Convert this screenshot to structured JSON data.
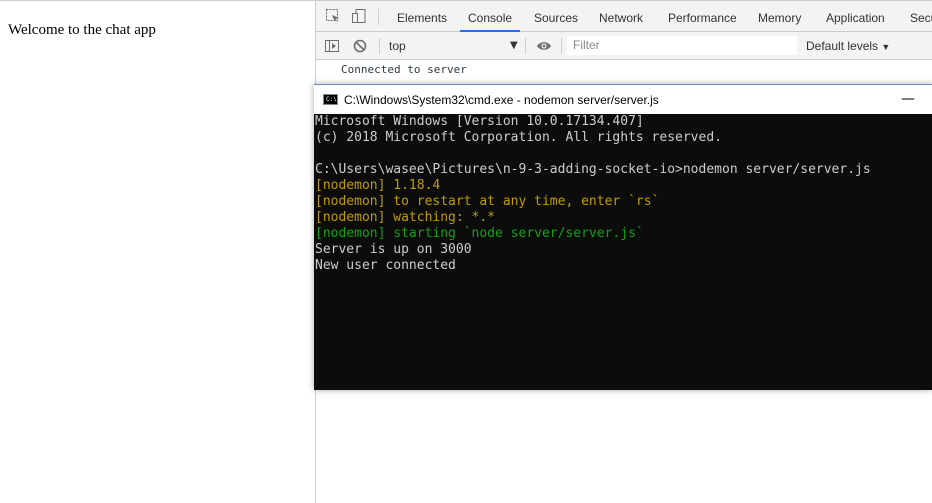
{
  "page": {
    "welcome_text": "Welcome to the chat app"
  },
  "devtools": {
    "tabs": [
      {
        "label": "Elements",
        "active": false
      },
      {
        "label": "Console",
        "active": true
      },
      {
        "label": "Sources",
        "active": false
      },
      {
        "label": "Network",
        "active": false
      },
      {
        "label": "Performance",
        "active": false
      },
      {
        "label": "Memory",
        "active": false
      },
      {
        "label": "Application",
        "active": false
      },
      {
        "label": "Secu",
        "active": false
      }
    ],
    "console": {
      "context": "top",
      "filter_placeholder": "Filter",
      "levels": "Default levels",
      "log": "Connected to server"
    },
    "accent_color": "#1a73e8"
  },
  "cmd": {
    "title": "C:\\Windows\\System32\\cmd.exe - nodemon  server/server.js",
    "icon_text": "C:\\",
    "minimize": "—",
    "lines": [
      {
        "text": "Microsoft Windows [Version 10.0.17134.407]",
        "color": "white"
      },
      {
        "text": "(c) 2018 Microsoft Corporation. All rights reserved.",
        "color": "white"
      },
      {
        "text": "",
        "color": "white"
      },
      {
        "text": "C:\\Users\\wasee\\Pictures\\n-9-3-adding-socket-io>nodemon server/server.js",
        "color": "white"
      },
      {
        "text": "[nodemon] 1.18.4",
        "color": "yellow"
      },
      {
        "text": "[nodemon] to restart at any time, enter `rs`",
        "color": "yellow"
      },
      {
        "text": "[nodemon] watching: *.*",
        "color": "yellow"
      },
      {
        "text": "[nodemon] starting `node server/server.js`",
        "color": "green"
      },
      {
        "text": "Server is up on 3000",
        "color": "white"
      },
      {
        "text": "New user connected",
        "color": "white"
      }
    ]
  }
}
